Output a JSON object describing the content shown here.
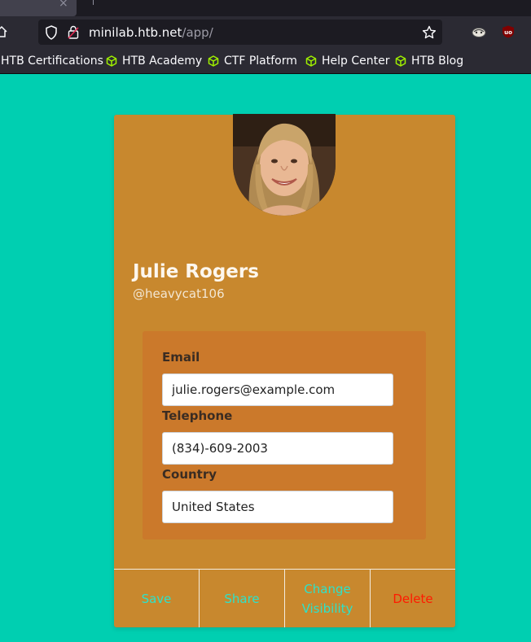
{
  "browser": {
    "tab_close_glyph": "×",
    "url_host": "minilab.htb.net",
    "url_path": "/app/",
    "icons": [
      "home-icon",
      "shield-icon",
      "lock-icon",
      "star-icon",
      "extension-icon",
      "ublock-icon"
    ]
  },
  "bookmarks": [
    {
      "label": "HTB Certifications",
      "icon": "none"
    },
    {
      "label": "HTB Academy",
      "icon": "cube-icon"
    },
    {
      "label": "CTF Platform",
      "icon": "cube-icon"
    },
    {
      "label": "Help Center",
      "icon": "cube-icon"
    },
    {
      "label": "HTB Blog",
      "icon": "cube-icon"
    }
  ],
  "profile": {
    "name": "Julie Rogers",
    "handle": "@heavycat106",
    "avatar": "profile-photo"
  },
  "form": {
    "email_label": "Email",
    "email_value": "julie.rogers@example.com",
    "telephone_label": "Telephone",
    "telephone_value": "(834)-609-2003",
    "country_label": "Country",
    "country_value": "United States"
  },
  "actions": {
    "save": "Save",
    "share": "Share",
    "visibility_line1": "Change",
    "visibility_line2": "Visibility",
    "delete": "Delete"
  },
  "colors": {
    "page_background": "#00cfb1",
    "card": "#c8882e",
    "form_panel": "#cb792b",
    "action_text": "#2de2c9",
    "delete_text": "#ff1a00"
  }
}
